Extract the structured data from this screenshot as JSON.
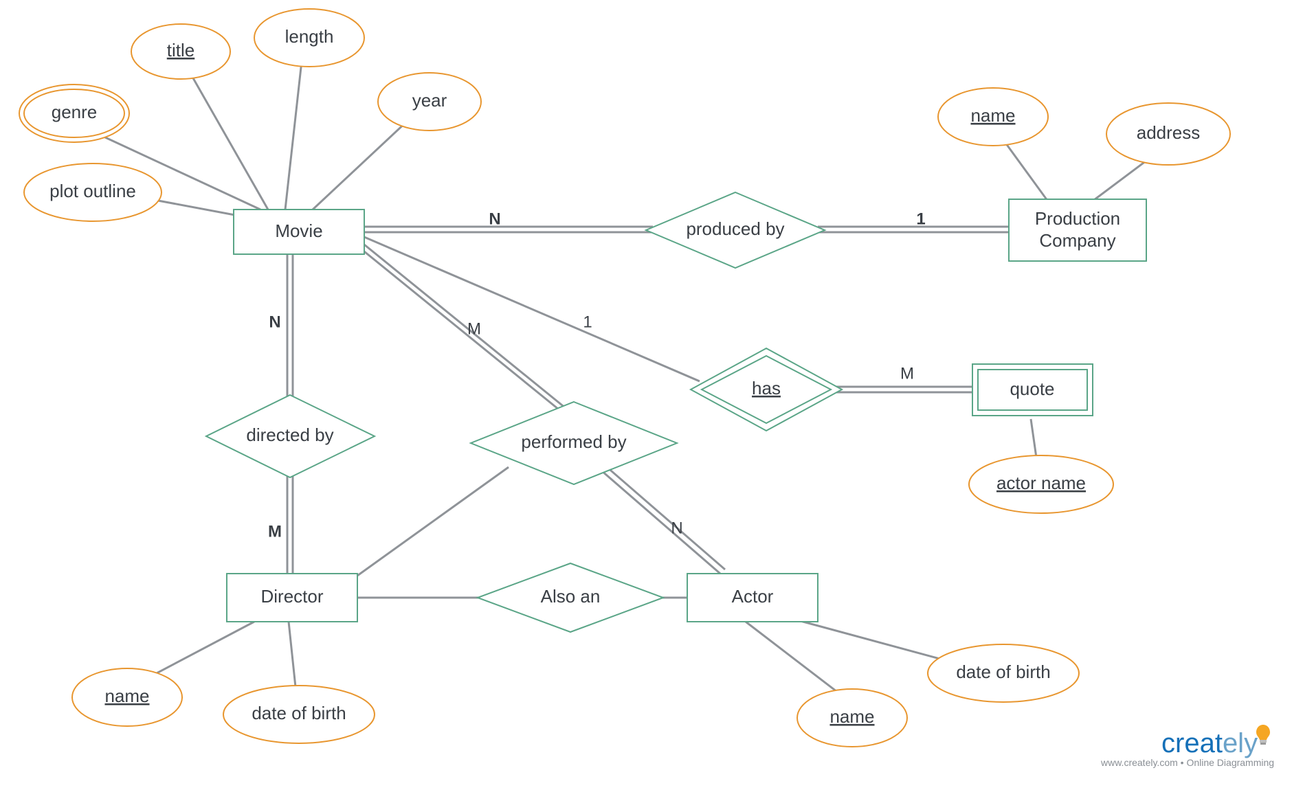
{
  "entities": {
    "movie": "Movie",
    "production_company_l1": "Production",
    "production_company_l2": "Company",
    "director": "Director",
    "actor": "Actor",
    "quote": "quote"
  },
  "attributes": {
    "genre": "genre",
    "title": "title",
    "length": "length",
    "year": "year",
    "plot_outline": "plot outline",
    "pc_name": "name",
    "pc_address": "address",
    "actor_name_attr": "actor name",
    "director_name": "name",
    "director_dob": "date of birth",
    "actor_name": "name",
    "actor_dob": "date of birth"
  },
  "relationships": {
    "produced_by": "produced by",
    "directed_by": "directed by",
    "performed_by": "performed by",
    "has": "has",
    "also_an": "Also an"
  },
  "cardinalities": {
    "movie_prod_N": "N",
    "movie_prod_1": "1",
    "movie_dir_N": "N",
    "movie_dir_M": "M",
    "movie_perf_M": "M",
    "movie_perf_N": "N",
    "movie_has_1": "1",
    "has_quote_M": "M"
  },
  "logo": {
    "part1": "creat",
    "part2": "ely",
    "sub": "www.creately.com • Online Diagramming"
  }
}
